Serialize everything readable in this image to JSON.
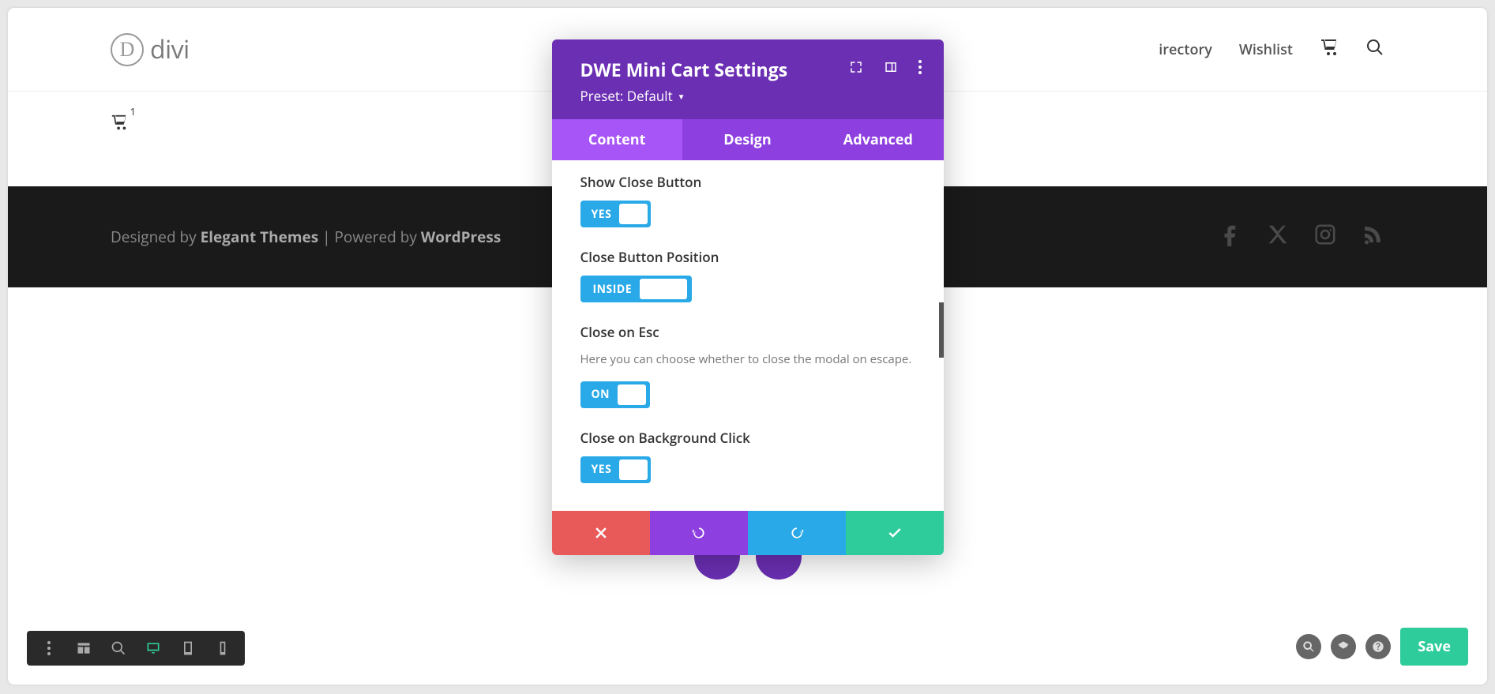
{
  "header": {
    "logo_letter": "D",
    "logo_text": "divi",
    "nav": {
      "item0": "irectory",
      "item1": "Wishlist"
    }
  },
  "cart": {
    "count": "1"
  },
  "footer": {
    "designed_by": "Designed by ",
    "theme": "Elegant Themes",
    "powered": " | Powered by ",
    "platform": "WordPress"
  },
  "modal": {
    "title": "DWE Mini Cart Settings",
    "preset": "Preset: Default",
    "tabs": {
      "content": "Content",
      "design": "Design",
      "advanced": "Advanced"
    },
    "settings": {
      "show_close": {
        "label": "Show Close Button",
        "value": "YES"
      },
      "close_pos": {
        "label": "Close Button Position",
        "value": "INSIDE"
      },
      "close_esc": {
        "label": "Close on Esc",
        "desc": "Here you can choose whether to close the modal on escape.",
        "value": "ON"
      },
      "close_bg": {
        "label": "Close on Background Click",
        "value": "YES"
      }
    }
  },
  "actions": {
    "save": "Save"
  }
}
